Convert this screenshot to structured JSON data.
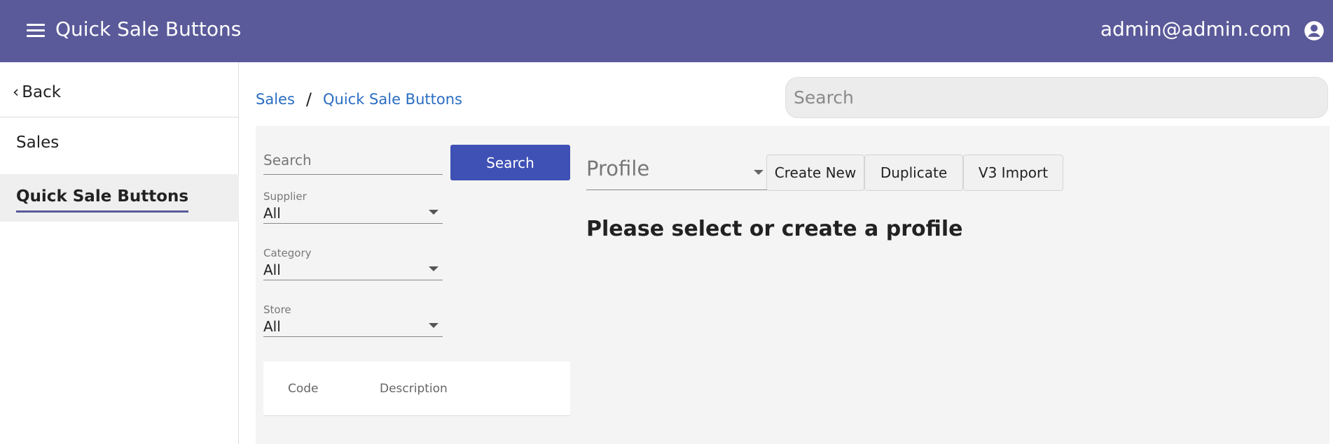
{
  "header": {
    "title": "Quick Sale Buttons",
    "user_email": "admin@admin.com",
    "menu_icon": "menu-icon",
    "account_icon": "account-circle-icon"
  },
  "sidebar": {
    "back_label": "Back",
    "items": [
      {
        "label": "Sales"
      },
      {
        "label": "Quick Sale Buttons",
        "active": true
      }
    ]
  },
  "breadcrumb": {
    "items": [
      "Sales",
      "Quick Sale Buttons"
    ],
    "separator": "/"
  },
  "top_search": {
    "placeholder": "Search"
  },
  "filters": {
    "search_placeholder": "Search",
    "search_button_label": "Search",
    "supplier": {
      "label": "Supplier",
      "value": "All"
    },
    "category": {
      "label": "Category",
      "value": "All"
    },
    "store": {
      "label": "Store",
      "value": "All"
    }
  },
  "table": {
    "headers": [
      "Code",
      "Description"
    ]
  },
  "profile": {
    "placeholder": "Profile",
    "buttons": [
      "Create New",
      "Duplicate",
      "V3 Import"
    ],
    "empty_message": "Please select or create a profile"
  },
  "colors": {
    "header_bg": "#5a5a9a",
    "primary_button": "#3f51b5",
    "link": "#2a6dc2",
    "panel_bg": "#f4f4f4"
  }
}
